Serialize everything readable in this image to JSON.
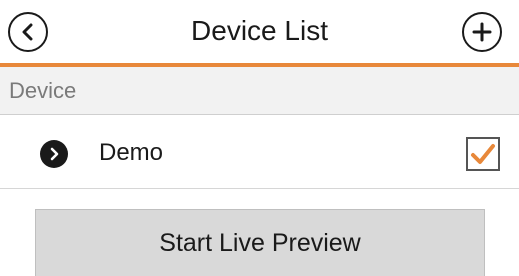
{
  "navbar": {
    "title": "Device List",
    "back_icon": "chevron-left-icon",
    "add_icon": "plus-icon",
    "accent_color": "#e8883a"
  },
  "section": {
    "header": "Device"
  },
  "devices": [
    {
      "name": "Demo",
      "checked": true,
      "icon": "chevron-right-icon",
      "check_color": "#e8883a"
    }
  ],
  "actions": {
    "start_live_preview": "Start Live Preview"
  }
}
